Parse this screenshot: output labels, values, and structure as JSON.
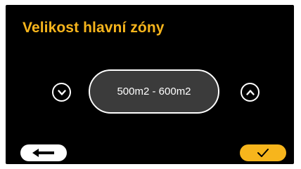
{
  "screen": {
    "title": "Velikost hlavní zóny",
    "value": "500m2 - 600m2"
  },
  "controls": {
    "decrease_icon": "chevron-down-icon",
    "increase_icon": "chevron-up-icon",
    "back_icon": "arrow-left-icon",
    "confirm_icon": "check-icon"
  },
  "colors": {
    "accent": "#f7b51c",
    "background": "#000000",
    "value_pill": "#3b3b3b",
    "foreground": "#ffffff"
  }
}
